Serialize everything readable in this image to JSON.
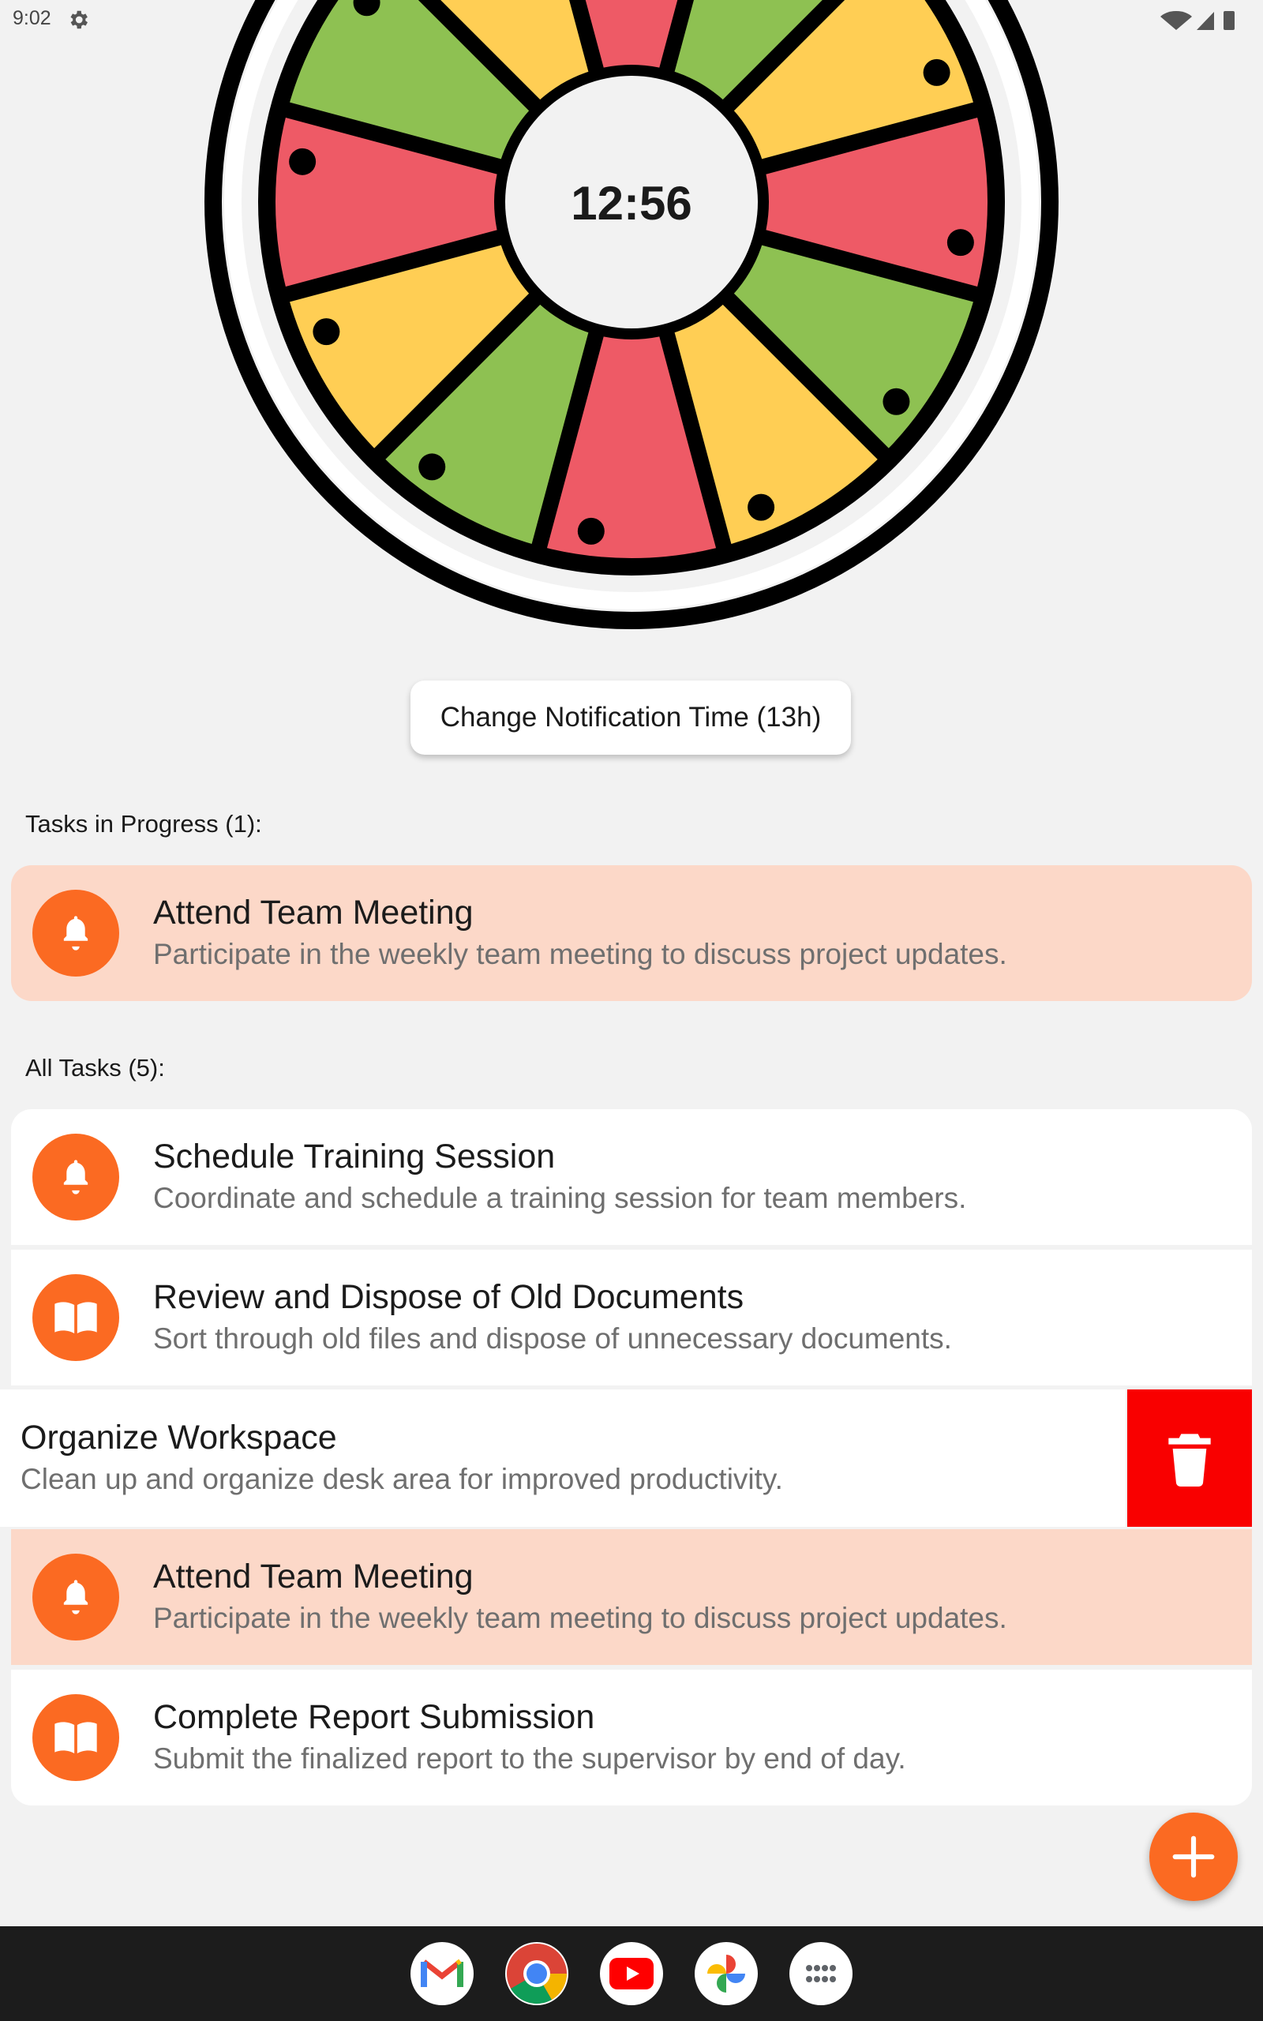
{
  "status_bar": {
    "time": "9:02"
  },
  "timer": {
    "display": "12:56"
  },
  "notify_button": {
    "label": "Change Notification Time (13h)"
  },
  "in_progress": {
    "heading": "Tasks in Progress (1):",
    "tasks": [
      {
        "title": "Attend Team Meeting",
        "description": "Participate in the weekly team meeting to discuss project updates.",
        "icon": "bell-icon"
      }
    ]
  },
  "all_tasks": {
    "heading": "All Tasks (5):",
    "tasks": [
      {
        "title": "Schedule Training Session",
        "description": "Coordinate and schedule a training session for team members.",
        "icon": "bell-icon"
      },
      {
        "title": "Review and Dispose of Old Documents",
        "description": "Sort through old files and dispose of unnecessary documents.",
        "icon": "book-icon"
      },
      {
        "title": "Organize Workspace",
        "description": "Clean up and organize desk area for improved productivity.",
        "icon": "book-icon",
        "swiped": true
      },
      {
        "title": "Attend Team Meeting",
        "description": "Participate in the weekly team meeting to discuss project updates.",
        "icon": "bell-icon",
        "in_progress": true
      },
      {
        "title": "Complete Report Submission",
        "description": "Submit the finalized report to the supervisor by end of day.",
        "icon": "book-icon"
      }
    ]
  },
  "fab": {
    "icon": "plus-icon"
  },
  "dock": {
    "apps": [
      "gmail-icon",
      "chrome-icon",
      "youtube-icon",
      "photos-icon",
      "app-drawer-icon"
    ]
  },
  "colors": {
    "accent": "#fb6a22",
    "active_card": "#fcd8c8",
    "delete": "#f90000",
    "wheel_red": "#ee5a66",
    "wheel_green": "#8ec152",
    "wheel_yellow": "#ffce54"
  }
}
